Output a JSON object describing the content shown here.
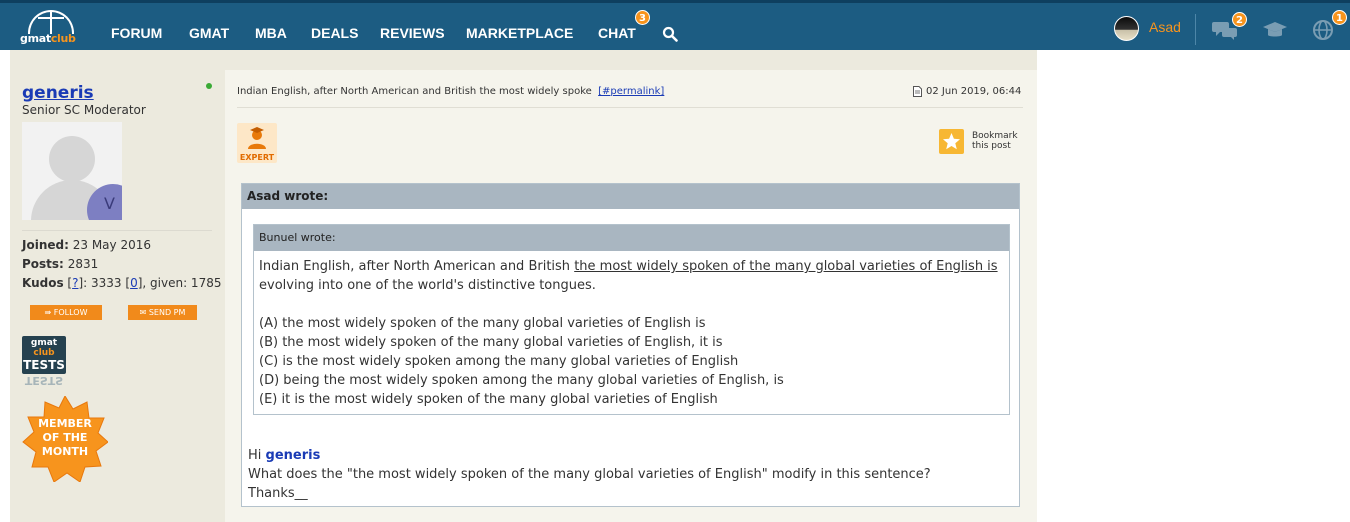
{
  "header": {
    "logo_text_a": "gmat",
    "logo_text_b": "club",
    "nav": [
      "FORUM",
      "GMAT",
      "MBA",
      "DEALS",
      "REVIEWS",
      "MARKETPLACE",
      "CHAT"
    ],
    "chat_badge": "3",
    "user": "Asad",
    "messages_badge": "2",
    "globe_badge": "1",
    "accent_color": "#f7941d",
    "bar_color": "#1c5c82"
  },
  "sidebar": {
    "username": "generis",
    "role": "Senior SC Moderator",
    "avatar_letter": "V",
    "joined_label": "Joined:",
    "joined_value": "23 May 2016",
    "posts_label": "Posts:",
    "posts_value": "2831",
    "kudos_label": "Kudos",
    "kudos_q": "?",
    "kudos_value": "3333",
    "kudos_zero": "0",
    "kudos_given": ", given: 1785",
    "follow_label": "FOLLOW",
    "sendpm_label": "SEND PM",
    "tests_badge": [
      "gmat",
      "club",
      "TESTS"
    ],
    "tests_reflection": "TESTS",
    "motm_badge": [
      "MEMBER",
      "OF THE",
      "MONTH"
    ]
  },
  "post": {
    "subject": "Indian English, after North American and British the most widely spoke",
    "permalink": "[#permalink]",
    "date": "02 Jun 2019, 06:44",
    "expert_label": "EXPERT",
    "bookmark_line1": "Bookmark",
    "bookmark_line2": "this post",
    "outer_quote_author": "Asad wrote:",
    "inner_quote_author": "Bunuel wrote:",
    "inner_line1_a": "Indian English, after North American and British ",
    "inner_line1_b": "the most widely spoken of the many global varieties of English is",
    "inner_line2": "evolving into one of the world's distinctive tongues.",
    "options": [
      "(A) the most widely spoken of the many global varieties of English is",
      "(B) the most widely spoken of the many global varieties of English, it is",
      "(C) is the most widely spoken among the many global varieties of English",
      "(D) being the most widely spoken among the many global varieties of English, is",
      "(E) it is the most widely spoken of the many global varieties of English"
    ],
    "reply_greeting": "Hi ",
    "reply_mention": "generis",
    "reply_line": "What does the \"the most widely spoken of the many global varieties of English\" modify in this sentence?",
    "reply_sign": "Thanks__"
  }
}
